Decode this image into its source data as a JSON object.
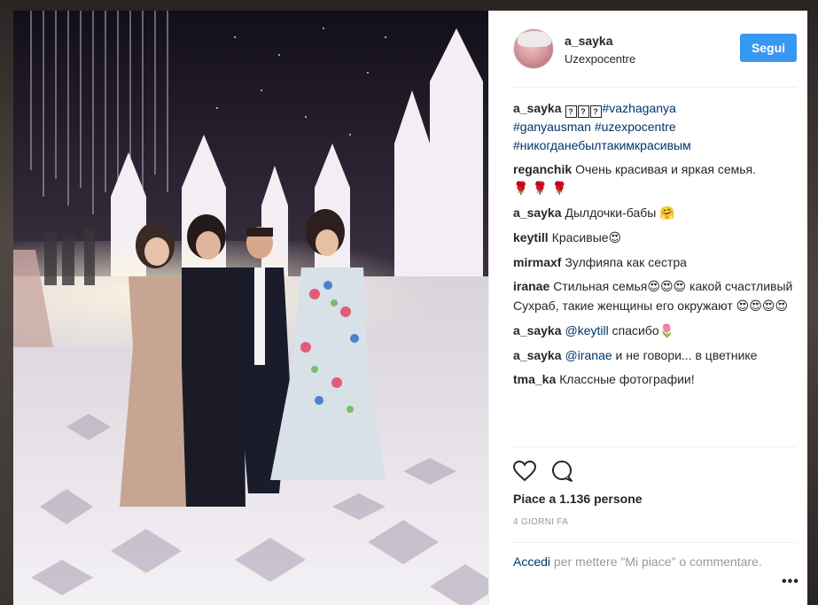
{
  "post": {
    "author": "a_sayka",
    "location": "Uzexpocentre",
    "follow_label": "Segui",
    "caption": {
      "user": "a_sayka",
      "tofu_glyphs": [
        "?",
        "?",
        "?"
      ],
      "tag1": "#vazhaganya",
      "tag2": "#ganyausman",
      "tag3": "#uzexpocentre",
      "tag4": "#никогданебылтакимкрасивым"
    },
    "comments": [
      {
        "user": "reganchik",
        "text": "Очень красивая и яркая семья.",
        "emoji": "🌹 🌹 🌹"
      },
      {
        "user": "a_sayka",
        "text": "Дылдочки-бабы",
        "emoji": "🤗"
      },
      {
        "user": "keytill",
        "text": "Красивые",
        "emoji": "😍"
      },
      {
        "user": "mirmaxf",
        "text": "Зулфияпа как сестра",
        "emoji": ""
      },
      {
        "user": "iranae",
        "text_a": "Стильная семья",
        "emoji_a": "😍😍😍",
        "text_b": " какой счастливый Сухраб, такие женщины его окружают ",
        "emoji_b": "😍😍😍😍"
      },
      {
        "user": "a_sayka",
        "mention": "@keytill",
        "text": " спасибо",
        "emoji": "🌷"
      },
      {
        "user": "a_sayka",
        "mention": "@iranae",
        "text": " и не говори... в цветнике",
        "emoji": ""
      },
      {
        "user": "tma_ka",
        "text": "Классные фотографии!",
        "emoji": ""
      }
    ],
    "likes_text": "Piace a 1.136 persone",
    "timestamp": "4 GIORNI FA",
    "login_link": "Accedi",
    "login_rest": " per mettere \"Mi piace\" o commentare.",
    "more_label": "•••"
  },
  "icons": {
    "like": "heart-outline-icon",
    "comment": "speech-bubble-icon",
    "more": "ellipsis-icon"
  },
  "colors": {
    "follow_button": "#3897f0",
    "link": "#003569",
    "muted_text": "#999999",
    "text": "#262626",
    "divider": "#efefef"
  }
}
